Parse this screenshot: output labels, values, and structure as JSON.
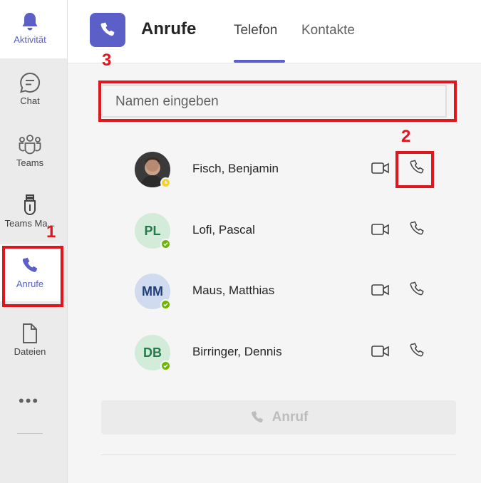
{
  "rail": {
    "items": [
      {
        "label": "Aktivität",
        "icon": "bell-icon"
      },
      {
        "label": "Chat",
        "icon": "chat-icon"
      },
      {
        "label": "Teams",
        "icon": "teams-icon"
      },
      {
        "label": "Teams Ma...",
        "icon": "usb-icon"
      },
      {
        "label": "Anrufe",
        "icon": "phone-icon"
      },
      {
        "label": "Dateien",
        "icon": "file-icon"
      }
    ],
    "more": "•••"
  },
  "header": {
    "title": "Anrufe",
    "tabs": [
      "Telefon",
      "Kontakte"
    ]
  },
  "search": {
    "placeholder": "Namen eingeben"
  },
  "contacts": [
    {
      "name": "Fisch, Benjamin",
      "initials": "",
      "status": "away"
    },
    {
      "name": "Lofi, Pascal",
      "initials": "PL",
      "status": "available"
    },
    {
      "name": "Maus, Matthias",
      "initials": "MM",
      "status": "available"
    },
    {
      "name": "Birringer, Dennis",
      "initials": "DB",
      "status": "available"
    }
  ],
  "call_button": {
    "label": "Anruf"
  },
  "annotations": {
    "n1": "1",
    "n2": "2",
    "n3": "3"
  },
  "colors": {
    "accent": "#5b5fc7",
    "highlight": "#e0161f",
    "available": "#6bb700",
    "away": "#f8d22a"
  }
}
